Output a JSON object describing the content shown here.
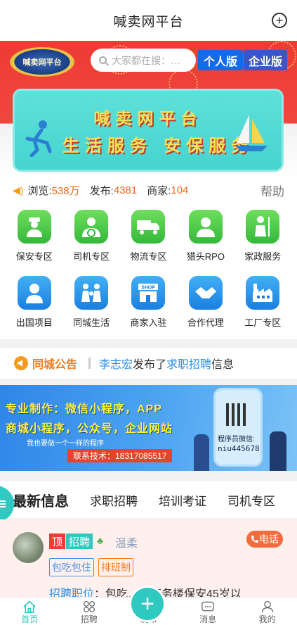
{
  "header": {
    "title": "喊卖网平台"
  },
  "hero": {
    "logo_text": "喊卖网平台",
    "search_placeholder": "大家都在搜：…",
    "version_personal": "个人版",
    "version_enterprise": "企业版",
    "banner_line1": "喊卖网平台",
    "banner_line2": "生活服务 安保服务"
  },
  "stats": {
    "views_label": "浏览:",
    "views_value": "538万",
    "posts_label": "发布:",
    "posts_value": "4381",
    "merchants_label": "商家:",
    "merchants_value": "104",
    "help_label": "帮助"
  },
  "categories": [
    {
      "label": "保安专区",
      "icon": "security-guard-icon",
      "color": "green"
    },
    {
      "label": "司机专区",
      "icon": "driver-icon",
      "color": "green"
    },
    {
      "label": "物流专区",
      "icon": "truck-icon",
      "color": "green"
    },
    {
      "label": "猎头RPO",
      "icon": "headhunter-icon",
      "color": "green"
    },
    {
      "label": "家政服务",
      "icon": "housekeeping-icon",
      "color": "green"
    },
    {
      "label": "出国项目",
      "icon": "person-icon",
      "color": "blue"
    },
    {
      "label": "同城生活",
      "icon": "family-icon",
      "color": "blue"
    },
    {
      "label": "商家入驻",
      "icon": "shop-icon",
      "color": "blue"
    },
    {
      "label": "合作代理",
      "icon": "handshake-icon",
      "color": "blue"
    },
    {
      "label": "工厂专区",
      "icon": "factory-icon",
      "color": "blue"
    }
  ],
  "notice": {
    "tag": "同城公告",
    "user": "李志宏",
    "verb": "发布了",
    "category": "求职招聘",
    "suffix": "信息"
  },
  "ad": {
    "line1": "专业制作：微信小程序，APP",
    "line2": "商城小程序，公众号，企业网站",
    "line3": "我也要做一个一样的程序",
    "contact": "联系技术：18317085517",
    "wechat_label": "程序员微信:",
    "wechat_id": "niu445678"
  },
  "tabs": [
    {
      "label": "最新信息",
      "active": true
    },
    {
      "label": "求职招聘",
      "active": false
    },
    {
      "label": "培训考证",
      "active": false
    },
    {
      "label": "司机专区",
      "active": false
    }
  ],
  "listing": {
    "badge_top": "顶",
    "badge_type": "招聘",
    "username": "温柔",
    "call_label": "电话",
    "tags": [
      "包吃包住",
      "排班制"
    ],
    "job_key": "招聘职位",
    "job_text": "：包吃…了商务楼保安45岁以"
  },
  "nav": [
    {
      "label": "首页",
      "icon": "home-icon",
      "active": true
    },
    {
      "label": "招聘",
      "icon": "grid-icon",
      "active": false
    },
    {
      "label": "发布",
      "icon": "plus-icon",
      "active": false
    },
    {
      "label": "消息",
      "icon": "message-icon",
      "active": false
    },
    {
      "label": "我的",
      "icon": "profile-icon",
      "active": false
    }
  ],
  "colors": {
    "brand": "#2ec9c0",
    "hero_red": "#ee3b34",
    "accent_orange": "#f27b1a",
    "link_blue": "#2b8fe6"
  }
}
